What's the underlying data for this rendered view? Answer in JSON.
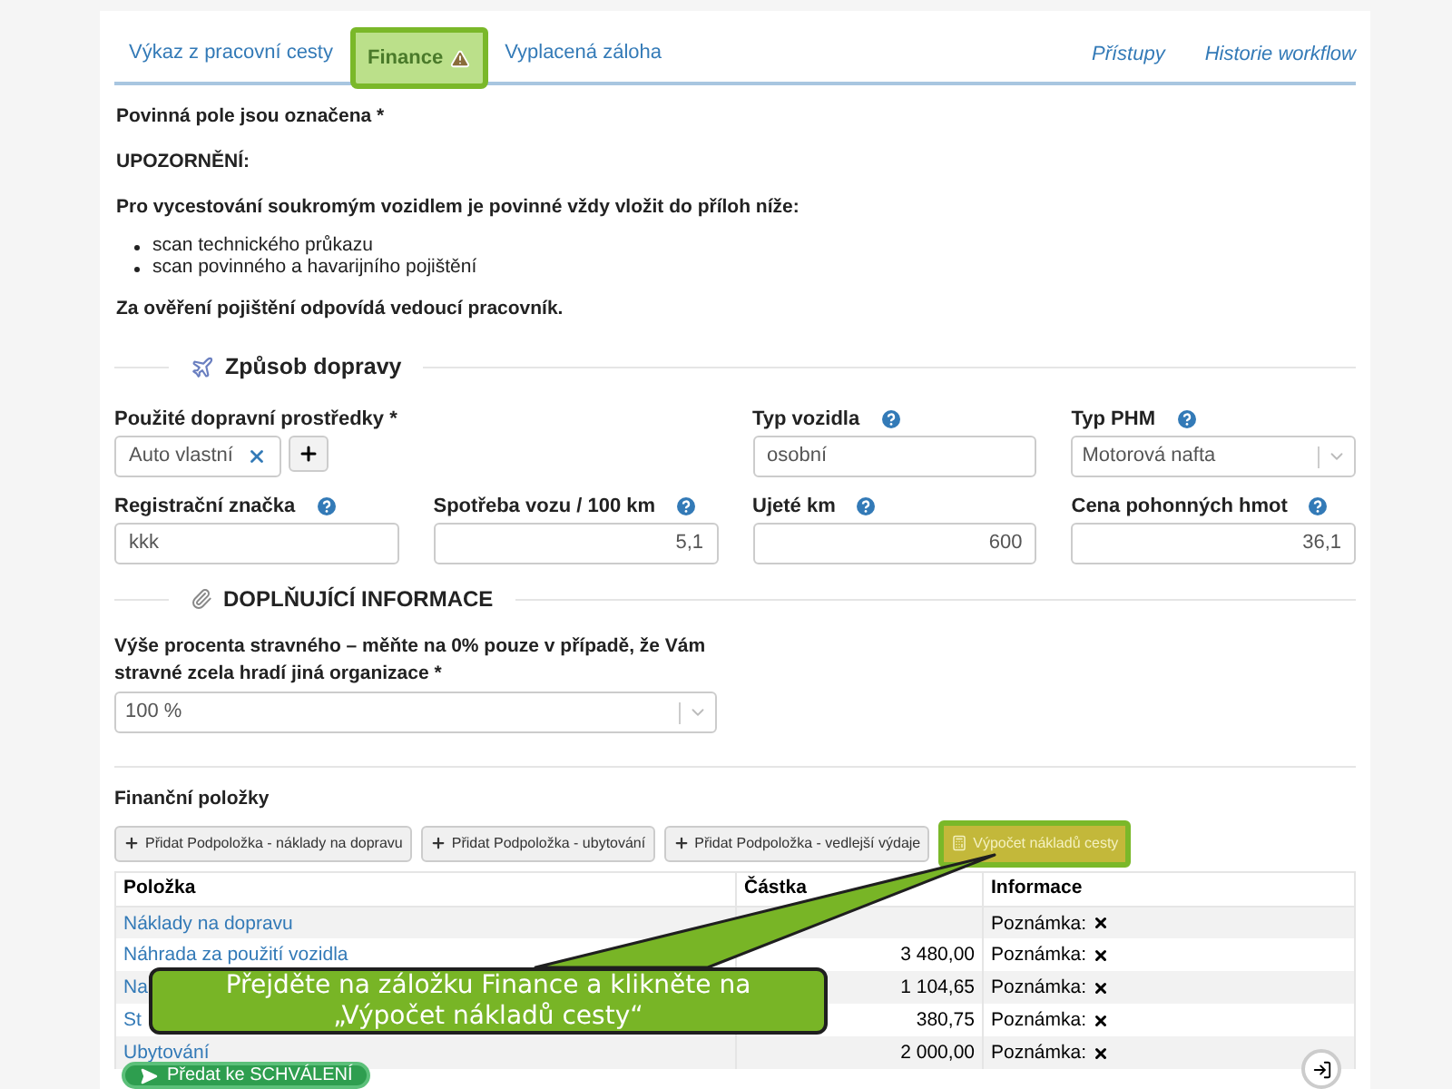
{
  "tabs": [
    {
      "label": "Výkaz z pracovní cesty",
      "selected": false,
      "highlighted": false,
      "warning": false
    },
    {
      "label": "Finance",
      "selected": true,
      "highlighted": true,
      "warning": true
    },
    {
      "label": "Vyplacená záloha",
      "selected": false,
      "highlighted": false,
      "warning": false
    }
  ],
  "right_links": [
    "Přístupy",
    "Historie workflow"
  ],
  "notice": {
    "required_note": "Povinná pole jsou označena *",
    "warning_title": "UPOZORNĚNÍ:",
    "warning_text": "Pro vycestování soukromým vozidlem je povinné vždy vložit do příloh níže:",
    "items": [
      "scan technického průkazu",
      "scan povinného a havarijního pojištění"
    ],
    "footer": "Za ověření pojištění odpovídá vedoucí pracovník."
  },
  "transport": {
    "title": "Způsob dopravy",
    "fields": [
      {
        "kind": "tags",
        "label": "Použité dopravní prostředky *",
        "value": "Auto vlastní"
      },
      {
        "kind": "spacer"
      },
      {
        "kind": "input",
        "label": "Typ vozidla",
        "value": "osobní",
        "help": true
      },
      {
        "kind": "select",
        "label": "Typ PHM",
        "value": "Motorová nafta",
        "help": true
      },
      {
        "kind": "input",
        "label": "Registrační značka",
        "value": "kkk",
        "help": true
      },
      {
        "kind": "number",
        "label": "Spotřeba vozu / 100 km",
        "value": "5,1",
        "help": true
      },
      {
        "kind": "number",
        "label": "Ujeté km",
        "value": "600",
        "help": true
      },
      {
        "kind": "number",
        "label": "Cena pohonných hmot",
        "value": "36,1",
        "help": true
      }
    ]
  },
  "additional": {
    "title": "DOPLŇUJÍCÍ INFORMACE",
    "label": "Výše procenta stravného – měňte na 0% pouze v případě, že Vám stravné zcela hradí jiná organizace *",
    "value": "100 %"
  },
  "finance": {
    "title": "Finanční položky",
    "buttons": [
      {
        "kind": "add",
        "label": "Přidat Podpoložka - náklady na dopravu",
        "highlighted": false
      },
      {
        "kind": "add",
        "label": "Přidat Podpoložka - ubytování",
        "highlighted": false
      },
      {
        "kind": "add",
        "label": "Přidat Podpoložka - vedlejší výdaje",
        "highlighted": false
      },
      {
        "kind": "calc",
        "label": "Výpočet nákladů cesty",
        "highlighted": true
      }
    ],
    "columns": [
      "Položka",
      "Částka",
      "Informace"
    ],
    "rows": [
      {
        "item": "Náklady na dopravu",
        "note": "Poznámka:"
      },
      {
        "item": "Náhrada za použití vozidla",
        "amount": "3 480,00",
        "note": "Poznámka:"
      },
      {
        "item": "Na",
        "amount": "1 104,65",
        "note": "Poznámka:"
      },
      {
        "item": "St",
        "amount": "380,75",
        "note": "Poznámka:"
      },
      {
        "item": "Ubytování",
        "amount": "2 000,00",
        "note": "Poznámka:"
      }
    ]
  },
  "callout": {
    "lines": [
      "Přejděte na záložku Finance a klikněte na",
      "„Výpočet nákladů cesty“"
    ]
  },
  "submit_button": "Předat ke SCHVÁLENÍ"
}
